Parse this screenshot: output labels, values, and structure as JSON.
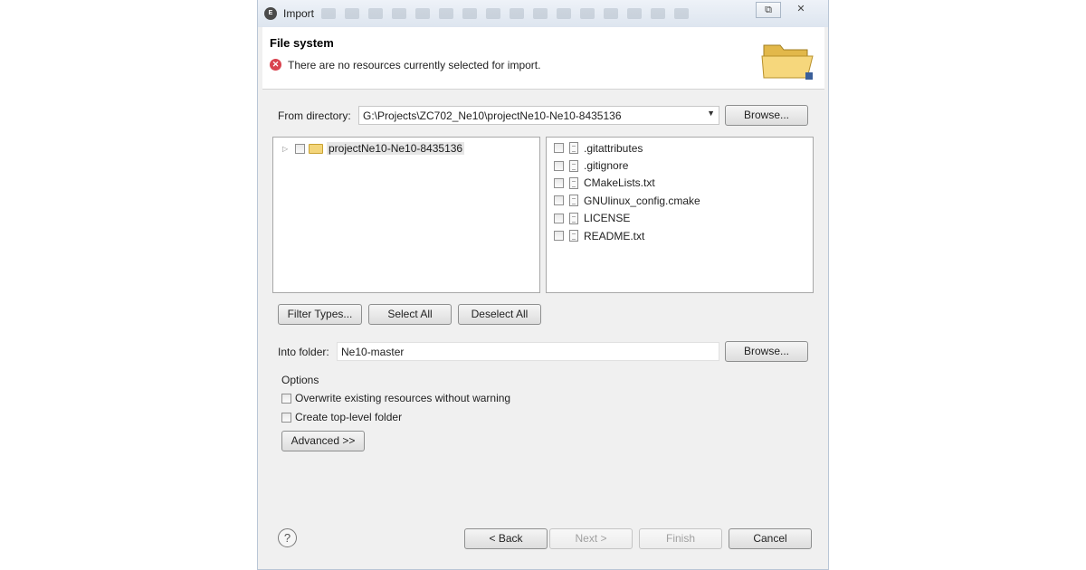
{
  "window": {
    "title": "Import",
    "app_icon": "eclipse-icon",
    "controls": {
      "restore": "⧉",
      "close": "✕"
    }
  },
  "header": {
    "page_title": "File system",
    "error_message": "There are no resources currently selected for import.",
    "error_icon": "error-icon",
    "banner_icon": "folder-open-icon"
  },
  "source": {
    "from_directory_label": "From directory:",
    "from_directory_value": "G:\\Projects\\ZC702_Ne10\\projectNe10-Ne10-8435136",
    "browse_label": "Browse..."
  },
  "tree": {
    "items": [
      {
        "label": "projectNe10-Ne10-8435136",
        "checked": false
      }
    ]
  },
  "files": [
    {
      "label": ".gitattributes",
      "checked": false
    },
    {
      "label": ".gitignore",
      "checked": false
    },
    {
      "label": "CMakeLists.txt",
      "checked": false
    },
    {
      "label": "GNUlinux_config.cmake",
      "checked": false
    },
    {
      "label": "LICENSE",
      "checked": false
    },
    {
      "label": "README.txt",
      "checked": false
    }
  ],
  "selection_buttons": {
    "filter_types": "Filter Types...",
    "select_all": "Select All",
    "deselect_all": "Deselect All"
  },
  "destination": {
    "into_folder_label": "Into folder:",
    "into_folder_value": "Ne10-master",
    "browse_label": "Browse..."
  },
  "options": {
    "title": "Options",
    "overwrite_label": "Overwrite existing resources without warning",
    "overwrite_checked": false,
    "create_top_level_label": "Create top-level folder",
    "create_top_level_checked": false,
    "advanced_label": "Advanced >>"
  },
  "footer": {
    "help_symbol": "?",
    "back_label": "< Back",
    "next_label": "Next >",
    "finish_label": "Finish",
    "cancel_label": "Cancel"
  }
}
